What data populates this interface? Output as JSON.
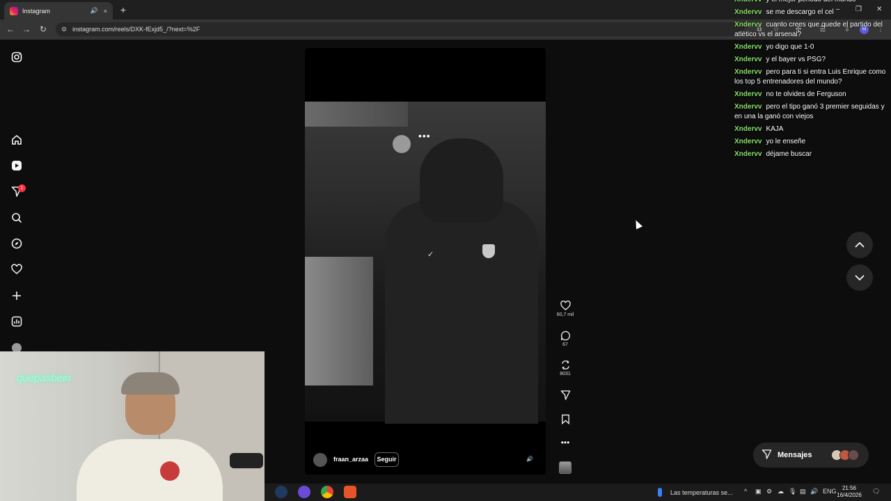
{
  "browser": {
    "tab_title": "Instagram",
    "tab_audio_icon": "speaker-icon",
    "tab_close": "×",
    "new_tab": "+",
    "url": "instagram.com/reels/DXK-fExjd5_/?next=%2F",
    "window_minimize": "–",
    "window_restore": "❐",
    "window_close": "✕",
    "profile_initial": "H"
  },
  "sidebar": {
    "items": [
      {
        "icon": "instagram-logo-icon"
      },
      {
        "icon": "home-icon"
      },
      {
        "icon": "reels-icon"
      },
      {
        "icon": "messages-icon",
        "badge": "1"
      },
      {
        "icon": "search-icon"
      },
      {
        "icon": "explore-icon"
      },
      {
        "icon": "notifications-heart-icon"
      },
      {
        "icon": "create-plus-icon"
      },
      {
        "icon": "dashboard-icon"
      },
      {
        "icon": "profile-avatar-icon"
      }
    ]
  },
  "reel": {
    "more_dots": "•••",
    "username": "fraan_arzaa",
    "follow_label": "Seguir",
    "likes": "60,7 mil",
    "comments": "67",
    "reposts": "8031"
  },
  "messages_pill": {
    "label": "Mensajes"
  },
  "chat": [
    {
      "nick": "Xndervv",
      "text": "y el mejor periodo del mundo"
    },
    {
      "nick": "Xndervv",
      "text": "se me descargo el cel"
    },
    {
      "nick": "Xndervv",
      "text": "cuanto crees que quede el partido del atlético vs el arsenal?"
    },
    {
      "nick": "Xndervv",
      "text": "yo digo que 1-0"
    },
    {
      "nick": "Xndervv",
      "text": "y el bayer vs PSG?"
    },
    {
      "nick": "Xndervv",
      "text": "pero para ti si entra Luis Enrique como los top 5 entrenadores del mundo?"
    },
    {
      "nick": "Xndervv",
      "text": "no te olvides de Ferguson"
    },
    {
      "nick": "Xndervv",
      "text": "pero el tipo ganó 3 premier seguidas y en una la ganó con viejos"
    },
    {
      "nick": "Xndervv",
      "text": "KAJA"
    },
    {
      "nick": "Xndervv",
      "text": "yo le enseñe"
    },
    {
      "nick": "Xndervv",
      "text": "déjame buscar"
    }
  ],
  "webcam": {
    "neon_sign": "quepasbein"
  },
  "taskbar": {
    "weather_text": "Las temperaturas se...",
    "language": "ENG",
    "time": "21:56",
    "date": "16/4/2026"
  },
  "colors": {
    "chat_nick": "#88e06a",
    "badge": "#ff3040",
    "background": "#0d0d0d"
  }
}
